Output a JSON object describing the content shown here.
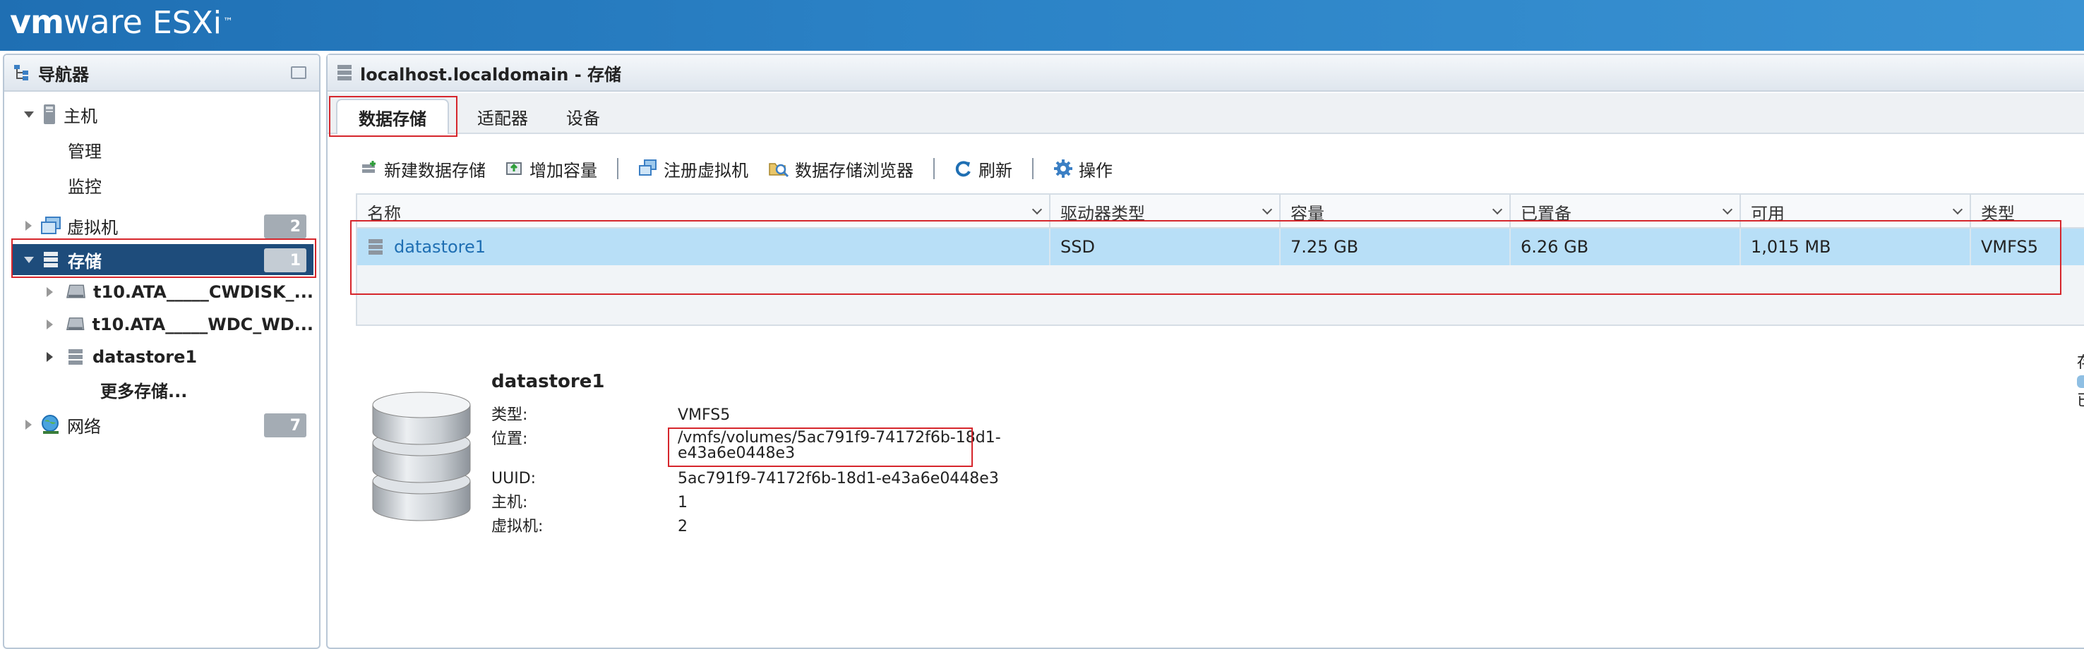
{
  "brand": {
    "vm": "vm",
    "ware": "ware",
    "product": "ESXi",
    "tm": "™"
  },
  "navigator": {
    "title": "导航器",
    "host": {
      "label": "主机",
      "children": [
        "管理",
        "监控"
      ]
    },
    "vms": {
      "label": "虚拟机",
      "count": "2"
    },
    "storage": {
      "label": "存储",
      "count": "1",
      "children": [
        "t10.ATA_____CWDISK_...",
        "t10.ATA_____WDC_WD...",
        "datastore1",
        "更多存储..."
      ]
    },
    "network": {
      "label": "网络",
      "count": "7"
    }
  },
  "main": {
    "title": "localhost.localdomain - 存储",
    "tabs": [
      "数据存储",
      "适配器",
      "设备"
    ],
    "toolbar": [
      "新建数据存储",
      "增加容量",
      "注册虚拟机",
      "数据存储浏览器",
      "刷新",
      "操作"
    ],
    "table": {
      "columns": [
        "名称",
        "驱动器类型",
        "容量",
        "已置备",
        "可用",
        "类型"
      ],
      "rows": [
        {
          "name": "datastore1",
          "drive_type": "SSD",
          "capacity": "7.25 GB",
          "provisioned": "6.26 GB",
          "free": "1,015 MB",
          "type": "VMFS5"
        }
      ]
    },
    "details": {
      "name": "datastore1",
      "fields": [
        {
          "label": "类型:",
          "value": "VMFS5"
        },
        {
          "label": "位置:",
          "value_line1": "/vmfs/volumes/5ac791f9-74172f6b-18d1-",
          "value_line2": "e43a6e0448e3"
        },
        {
          "label": "UUID:",
          "value": "5ac791f9-74172f6b-18d1-e43a6e0448e3"
        },
        {
          "label": "主机:",
          "value": "1"
        },
        {
          "label": "虚拟机:",
          "value": "2"
        }
      ]
    },
    "clipped_text": [
      "存",
      "已"
    ]
  },
  "colors": {
    "topbar": "#2b82c6",
    "selected_nav": "#1e4c7b",
    "selected_row": "#b8dff7",
    "annotation": "#d6262c"
  }
}
